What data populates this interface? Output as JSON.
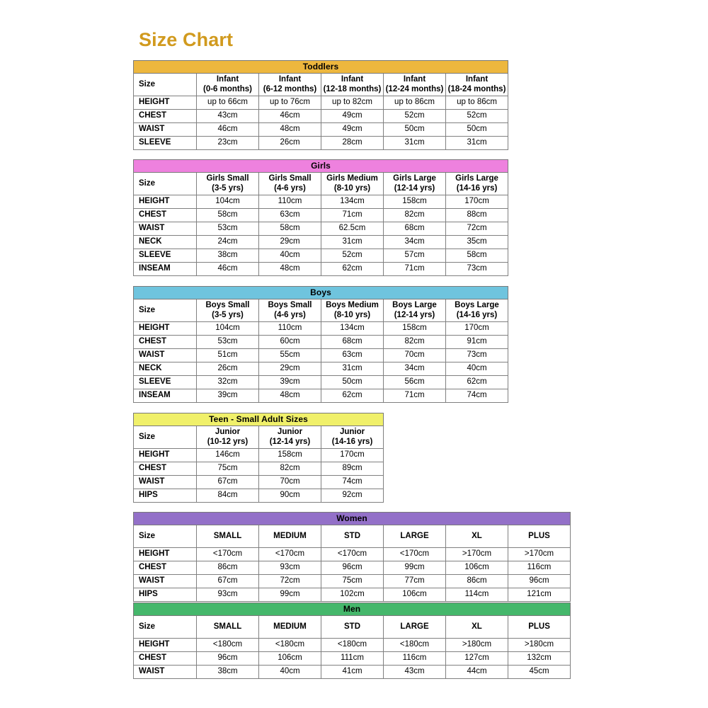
{
  "page": {
    "title": "Size Chart",
    "title_color": "#d19a1e"
  },
  "tables": [
    {
      "id": "toddlers",
      "banner": "Toddlers",
      "banner_color": "#edb73e",
      "size_label": "Size",
      "columns": [
        {
          "line1": "Infant",
          "line2": "(0-6 months)"
        },
        {
          "line1": "Infant",
          "line2": "(6-12 months)"
        },
        {
          "line1": "Infant",
          "line2": "(12-18 months)"
        },
        {
          "line1": "Infant",
          "line2": "(12-24 months)"
        },
        {
          "line1": "Infant",
          "line2": "(18-24 months)"
        }
      ],
      "rows": [
        {
          "label": "HEIGHT",
          "values": [
            "up to 66cm",
            "up to 76cm",
            "up to 82cm",
            "up to 86cm",
            "up to 86cm"
          ]
        },
        {
          "label": "CHEST",
          "values": [
            "43cm",
            "46cm",
            "49cm",
            "52cm",
            "52cm"
          ]
        },
        {
          "label": "WAIST",
          "values": [
            "46cm",
            "48cm",
            "49cm",
            "50cm",
            "50cm"
          ]
        },
        {
          "label": "SLEEVE",
          "values": [
            "23cm",
            "26cm",
            "28cm",
            "31cm",
            "31cm"
          ]
        }
      ]
    },
    {
      "id": "girls",
      "banner": "Girls",
      "banner_color": "#ee81de",
      "size_label": "Size",
      "columns": [
        {
          "line1": "Girls Small",
          "line2": "(3-5 yrs)"
        },
        {
          "line1": "Girls Small",
          "line2": "(4-6 yrs)"
        },
        {
          "line1": "Girls Medium",
          "line2": "(8-10 yrs)"
        },
        {
          "line1": "Girls Large",
          "line2": "(12-14 yrs)"
        },
        {
          "line1": "Girls Large",
          "line2": "(14-16 yrs)"
        }
      ],
      "rows": [
        {
          "label": "HEIGHT",
          "values": [
            "104cm",
            "110cm",
            "134cm",
            "158cm",
            "170cm"
          ]
        },
        {
          "label": "CHEST",
          "values": [
            "58cm",
            "63cm",
            "71cm",
            "82cm",
            "88cm"
          ]
        },
        {
          "label": "WAIST",
          "values": [
            "53cm",
            "58cm",
            "62.5cm",
            "68cm",
            "72cm"
          ]
        },
        {
          "label": "NECK",
          "values": [
            "24cm",
            "29cm",
            "31cm",
            "34cm",
            "35cm"
          ]
        },
        {
          "label": "SLEEVE",
          "values": [
            "38cm",
            "40cm",
            "52cm",
            "57cm",
            "58cm"
          ]
        },
        {
          "label": "INSEAM",
          "values": [
            "46cm",
            "48cm",
            "62cm",
            "71cm",
            "73cm"
          ]
        }
      ]
    },
    {
      "id": "boys",
      "banner": "Boys",
      "banner_color": "#6fc4de",
      "size_label": "Size",
      "columns": [
        {
          "line1": "Boys Small",
          "line2": "(3-5 yrs)"
        },
        {
          "line1": "Boys Small",
          "line2": "(4-6 yrs)"
        },
        {
          "line1": "Boys Medium",
          "line2": "(8-10 yrs)"
        },
        {
          "line1": "Boys Large",
          "line2": "(12-14 yrs)"
        },
        {
          "line1": "Boys Large",
          "line2": "(14-16 yrs)"
        }
      ],
      "rows": [
        {
          "label": "HEIGHT",
          "values": [
            "104cm",
            "110cm",
            "134cm",
            "158cm",
            "170cm"
          ]
        },
        {
          "label": "CHEST",
          "values": [
            "53cm",
            "60cm",
            "68cm",
            "82cm",
            "91cm"
          ]
        },
        {
          "label": "WAIST",
          "values": [
            "51cm",
            "55cm",
            "63cm",
            "70cm",
            "73cm"
          ]
        },
        {
          "label": "NECK",
          "values": [
            "26cm",
            "29cm",
            "31cm",
            "34cm",
            "40cm"
          ]
        },
        {
          "label": "SLEEVE",
          "values": [
            "32cm",
            "39cm",
            "50cm",
            "56cm",
            "62cm"
          ]
        },
        {
          "label": "INSEAM",
          "values": [
            "39cm",
            "48cm",
            "62cm",
            "71cm",
            "74cm"
          ]
        }
      ]
    },
    {
      "id": "teen",
      "banner": "Teen - Small Adult Sizes",
      "banner_color": "#f0f06a",
      "size_label": "Size",
      "columns": [
        {
          "line1": "Junior",
          "line2": "(10-12 yrs)"
        },
        {
          "line1": "Junior",
          "line2": "(12-14 yrs)"
        },
        {
          "line1": "Junior",
          "line2": "(14-16 yrs)"
        }
      ],
      "rows": [
        {
          "label": "HEIGHT",
          "values": [
            "146cm",
            "158cm",
            "170cm"
          ]
        },
        {
          "label": "CHEST",
          "values": [
            "75cm",
            "82cm",
            "89cm"
          ]
        },
        {
          "label": "WAIST",
          "values": [
            "67cm",
            "70cm",
            "74cm"
          ]
        },
        {
          "label": "HIPS",
          "values": [
            "84cm",
            "90cm",
            "92cm"
          ]
        }
      ]
    },
    {
      "id": "women",
      "banner": "Women",
      "banner_color": "#9370c8",
      "size_label": "Size",
      "columns": [
        {
          "line1": "SMALL",
          "line2": ""
        },
        {
          "line1": "MEDIUM",
          "line2": ""
        },
        {
          "line1": "STD",
          "line2": ""
        },
        {
          "line1": "LARGE",
          "line2": ""
        },
        {
          "line1": "XL",
          "line2": ""
        },
        {
          "line1": "PLUS",
          "line2": ""
        }
      ],
      "rows": [
        {
          "label": "HEIGHT",
          "values": [
            "<170cm",
            "<170cm",
            "<170cm",
            "<170cm",
            ">170cm",
            ">170cm"
          ]
        },
        {
          "label": "CHEST",
          "values": [
            "86cm",
            "93cm",
            "96cm",
            "99cm",
            "106cm",
            "116cm"
          ]
        },
        {
          "label": "WAIST",
          "values": [
            "67cm",
            "72cm",
            "75cm",
            "77cm",
            "86cm",
            "96cm"
          ]
        },
        {
          "label": "HIPS",
          "values": [
            "93cm",
            "99cm",
            "102cm",
            "106cm",
            "114cm",
            "121cm"
          ]
        }
      ]
    },
    {
      "id": "men",
      "banner": "Men",
      "banner_color": "#45b76b",
      "size_label": "Size",
      "columns": [
        {
          "line1": "SMALL",
          "line2": ""
        },
        {
          "line1": "MEDIUM",
          "line2": ""
        },
        {
          "line1": "STD",
          "line2": ""
        },
        {
          "line1": "LARGE",
          "line2": ""
        },
        {
          "line1": "XL",
          "line2": ""
        },
        {
          "line1": "PLUS",
          "line2": ""
        }
      ],
      "rows": [
        {
          "label": "HEIGHT",
          "values": [
            "<180cm",
            "<180cm",
            "<180cm",
            "<180cm",
            ">180cm",
            ">180cm"
          ]
        },
        {
          "label": "CHEST",
          "values": [
            "96cm",
            "106cm",
            "111cm",
            "116cm",
            "127cm",
            "132cm"
          ]
        },
        {
          "label": "WAIST",
          "values": [
            "38cm",
            "40cm",
            "41cm",
            "43cm",
            "44cm",
            "45cm"
          ]
        }
      ]
    }
  ]
}
